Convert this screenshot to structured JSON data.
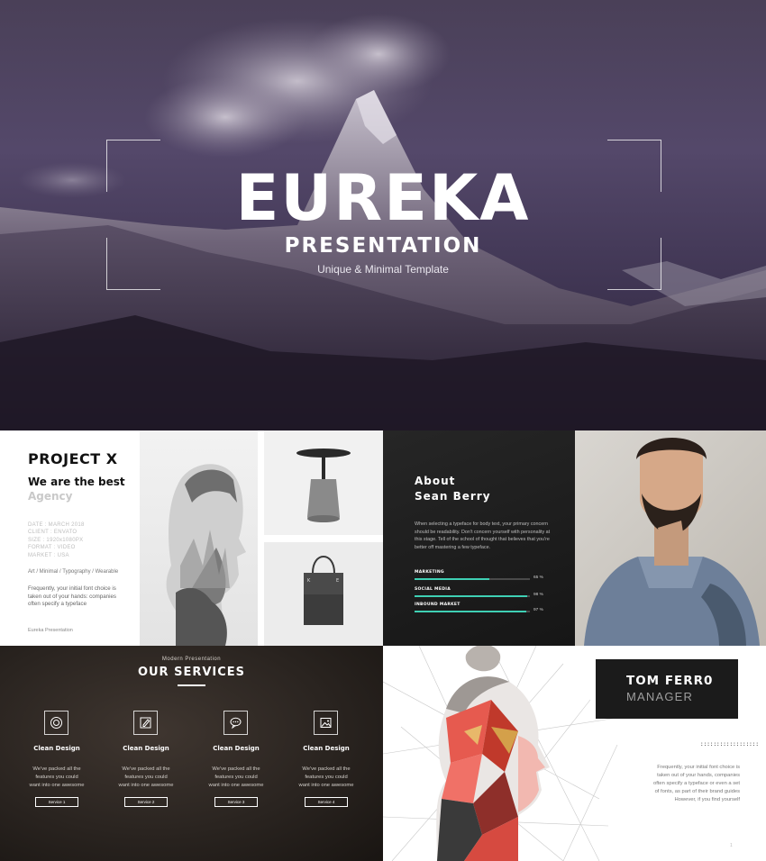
{
  "hero": {
    "title": "EUREKA",
    "subtitle": "PRESENTATION",
    "tagline": "Unique & Minimal Template"
  },
  "project_slide": {
    "title": "PROJECT X",
    "heading_line1": "We are the best",
    "heading_line2": "Agency",
    "meta": [
      "DATE : MARCH 2018",
      "CLIENT : ENVATO",
      "SIZE : 1920x1080PX",
      "FORMAT : VIDEO",
      "MARKET : USA"
    ],
    "tags": "Art  /  Minimal  /  Typography  /  Wearable",
    "body": "Frequently, your initial font choice is taken out of your hands: companies often specify a typeface",
    "footer": "Eureka  Presentation"
  },
  "about_slide": {
    "title_line1": "About",
    "title_line2": "Sean Berry",
    "body": "When selecting a typeface for body text, your primary concern should be readability. Don't concern yourself with personality at this stage. Tell of the school of thought that believes that you're better off mastering a few typeface.",
    "skills": [
      {
        "label": "MARKETING",
        "percent": 65,
        "percent_text": "65 %"
      },
      {
        "label": "SOCIAL MEDIA",
        "percent": 98,
        "percent_text": "98 %"
      },
      {
        "label": "INBOUND MARKET",
        "percent": 97,
        "percent_text": "97 %"
      }
    ],
    "accent_color": "#3fd0b4"
  },
  "services_slide": {
    "kicker": "Modern Presentation",
    "title": "OUR SERVICES",
    "services": [
      {
        "icon": "target-icon",
        "name": "Clean Design",
        "desc_line1": "We've packed all the",
        "desc_line2": "features you could",
        "desc_line3": "want into one awesome",
        "button": "Service 1"
      },
      {
        "icon": "pencil-icon",
        "name": "Clean Design",
        "desc_line1": "We've packed all the",
        "desc_line2": "features you could",
        "desc_line3": "want into one awesome",
        "button": "Service 2"
      },
      {
        "icon": "chat-icon",
        "name": "Clean Design",
        "desc_line1": "We've packed all the",
        "desc_line2": "features you could",
        "desc_line3": "want into one awesome",
        "button": "Service 3"
      },
      {
        "icon": "image-icon",
        "name": "Clean Design",
        "desc_line1": "We've packed all the",
        "desc_line2": "features you could",
        "desc_line3": "want into one awesome",
        "button": "Service 4"
      }
    ]
  },
  "manager_slide": {
    "name": "TOM FERR0",
    "role": "MANAGER",
    "dots": "::::::::::::::::::",
    "body": "Frequently, your initial font choice is taken out of your hands, companies often specify a typeface or even a set of fonts, as part of their brand guides However, if you find yourself",
    "page": "1"
  }
}
